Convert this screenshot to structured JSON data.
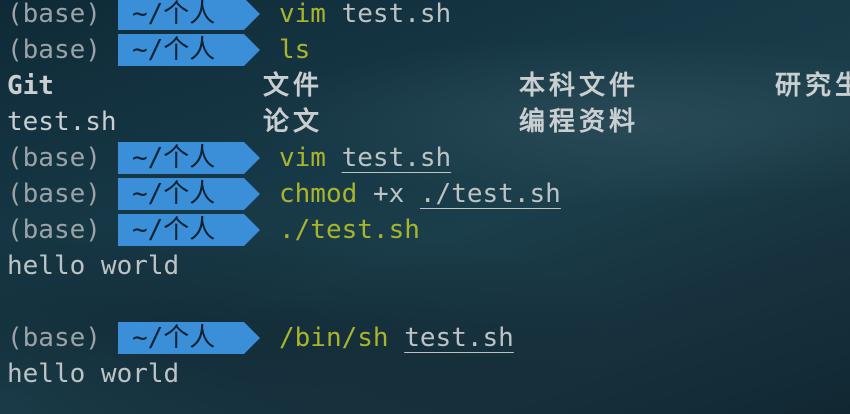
{
  "prompt": {
    "env": "(base)",
    "dir": "~/个人"
  },
  "lines": [
    {
      "type": "prompt",
      "cmd": "vim",
      "args": " test.sh"
    },
    {
      "type": "prompt",
      "cmd": "ls",
      "args": ""
    },
    {
      "type": "ls",
      "items": [
        "Git",
        "文件",
        "本科文件",
        "研究生"
      ]
    },
    {
      "type": "ls",
      "items": [
        "test.sh",
        "论文",
        "编程资料",
        ""
      ]
    },
    {
      "type": "prompt",
      "cmd": "vim",
      "args": "test.sh"
    },
    {
      "type": "prompt",
      "cmd": "chmod",
      "args": "+x",
      "args2": "./test.sh"
    },
    {
      "type": "prompt",
      "cmd": "./test.sh",
      "args": ""
    },
    {
      "type": "output",
      "text": "hello world"
    },
    {
      "type": "output",
      "text": ""
    },
    {
      "type": "prompt",
      "cmd": "/bin/sh",
      "args": "test.sh"
    },
    {
      "type": "output",
      "text": "hello world"
    }
  ],
  "colors": {
    "segment_bg": "#3b8ed8",
    "command": "#a8b52b",
    "text": "#bcc3c5"
  }
}
